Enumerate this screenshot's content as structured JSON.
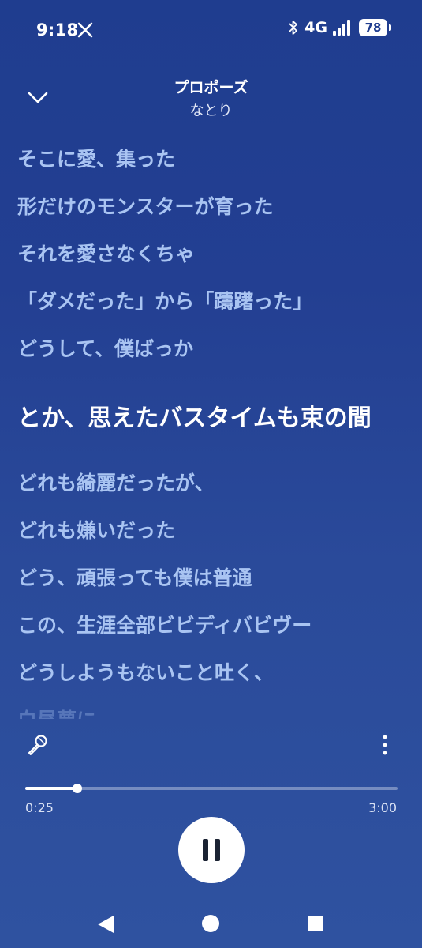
{
  "status_bar": {
    "time": "9:18",
    "network": "4G",
    "battery": "78",
    "icons": [
      "x-icon",
      "bluetooth-icon",
      "signal-icon",
      "battery-icon"
    ]
  },
  "header": {
    "title": "プロポーズ",
    "artist": "なとり",
    "collapse_icon": "chevron-down-icon"
  },
  "lyrics": {
    "lines": [
      "そこに愛、集った",
      "形だけのモンスターが育った",
      "それを愛さなくちゃ",
      "「ダメだった」から「躊躇った」",
      "どうして、僕ばっか",
      "とか、思えたバスタイムも束の間",
      "どれも綺麗だったが、",
      "どれも嫌いだった",
      "どう、頑張っても僕は普通",
      "この、生涯全部ビビディバビヴー",
      "どうしようもないこと吐く、",
      "白昼夢に"
    ],
    "active_index": 5
  },
  "controls": {
    "mic_icon": "microphone-icon",
    "more_icon": "more-vertical-icon",
    "current_time": "0:25",
    "total_time": "3:00",
    "progress_fraction": 0.139,
    "play_state_icon": "pause-icon"
  },
  "nav_bar": {
    "icons": [
      "back-icon",
      "home-icon",
      "recents-icon"
    ]
  },
  "colors": {
    "background_top": "#1f3d8f",
    "background_bottom": "#2f52a0",
    "lyric_inactive": "#a9c4f2",
    "lyric_active": "#ffffff"
  }
}
